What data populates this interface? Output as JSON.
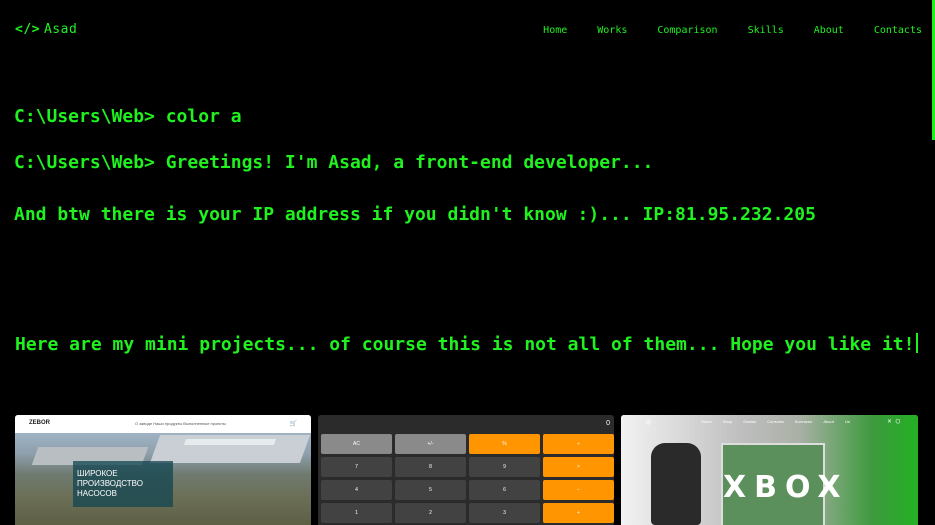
{
  "nav": {
    "logo_code": "</>",
    "logo_name": "Asad",
    "links": [
      "Home",
      "Works",
      "Comparison",
      "Skills",
      "About",
      "Contacts"
    ]
  },
  "terminal": {
    "line1": "C:\\Users\\Web> color a",
    "line2": "C:\\Users\\Web> Greetings! I'm Asad, a front-end developer...",
    "line3": "And btw there is your IP address if you didn't know :)... IP:81.95.232.205",
    "line4": "Here are my mini projects... of course this is not all of them... Hope you like it!"
  },
  "projects": {
    "p1": {
      "brand": "ZEBOR",
      "links": "О заводе   Наши продукты   Выполненные проекты",
      "hero_text": "ШИРОКОЕ\nПРОИЗВОДСТВО\nНАСОСОВ",
      "cart_icon": "cart-icon"
    },
    "p2": {
      "display": "0",
      "keys": [
        [
          "AC",
          "+/-",
          "%",
          "÷"
        ],
        [
          "7",
          "8",
          "9",
          "×"
        ],
        [
          "4",
          "5",
          "6",
          "−"
        ],
        [
          "1",
          "2",
          "3",
          "+"
        ]
      ]
    },
    "p3": {
      "title": "XBOX",
      "links": "Home Shop Games Consoles Контакты About Us"
    }
  },
  "colors": {
    "accent": "#1ff21f",
    "background": "#000000",
    "calc_orange": "#ff9500"
  }
}
